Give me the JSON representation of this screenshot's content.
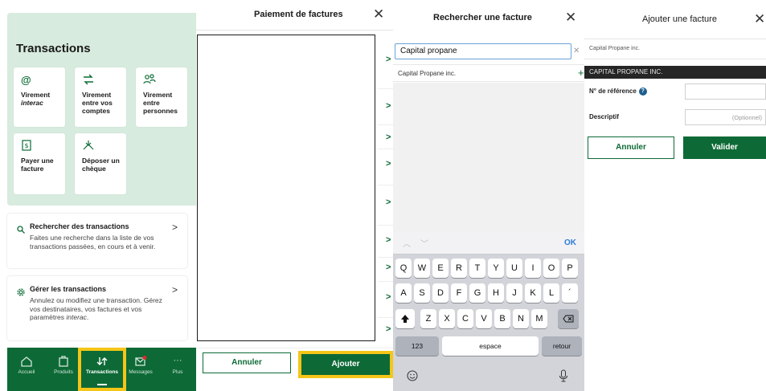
{
  "screen1": {
    "title": "Transactions",
    "tiles": [
      {
        "label_line1": "Virement",
        "label_line2": "interac",
        "icon": "at-sign-icon"
      },
      {
        "label": "Virement entre vos comptes",
        "icon": "transfer-arrows-icon"
      },
      {
        "label": "Virement entre personnes",
        "icon": "people-icon"
      },
      {
        "label": "Payer une facture",
        "icon": "bill-icon"
      },
      {
        "label": "Déposer un chèque",
        "icon": "cheque-deposit-icon"
      }
    ],
    "cards": [
      {
        "title": "Rechercher des transactions",
        "text": "Faites une recherche dans la liste de vos transactions passées, en cours et à venir.",
        "icon": "search-icon"
      },
      {
        "title": "Gérer les transactions",
        "text": "Annulez ou modifiez une transaction. Gérez vos destinataires, vos factures et vos paramètres ",
        "text_italic": "interac",
        "text_end": ".",
        "icon": "gear-icon"
      }
    ],
    "nav": [
      {
        "label": "Accueil",
        "icon": "home-icon"
      },
      {
        "label": "Produits",
        "icon": "products-icon"
      },
      {
        "label": "Transactions",
        "icon": "transactions-icon",
        "active": true
      },
      {
        "label": "Messages",
        "icon": "mail-icon"
      },
      {
        "label": "Plus",
        "icon": "more-icon"
      }
    ]
  },
  "screen2": {
    "title": "Paiement de factures",
    "cancel_label": "Annuler",
    "add_label": "Ajouter"
  },
  "screen3": {
    "title": "Rechercher une facture",
    "search_value": "Capital propane",
    "result": "Capital Propane inc.",
    "keyboard": {
      "ok": "OK",
      "row1": [
        "Q",
        "W",
        "E",
        "R",
        "T",
        "Y",
        "U",
        "I",
        "O",
        "P"
      ],
      "row2": [
        "A",
        "S",
        "D",
        "F",
        "G",
        "H",
        "J",
        "K",
        "L",
        "´"
      ],
      "row3": [
        "Z",
        "X",
        "C",
        "V",
        "B",
        "N",
        "M"
      ],
      "num": "123",
      "space": "espace",
      "return": "retour"
    }
  },
  "screen4": {
    "title": "Ajouter une facture",
    "supplier_name": "Capital Propane inc.",
    "supplier_banner": "CAPITAL PROPANE INC.",
    "reference_label": "N° de référence",
    "description_label": "Descriptif",
    "description_placeholder": "(Optionnel)",
    "cancel_label": "Annuler",
    "validate_label": "Valider"
  },
  "colors": {
    "brand_green": "#0d6a36",
    "highlight_yellow": "#f5c518",
    "tile_background": "#d7ebde"
  }
}
